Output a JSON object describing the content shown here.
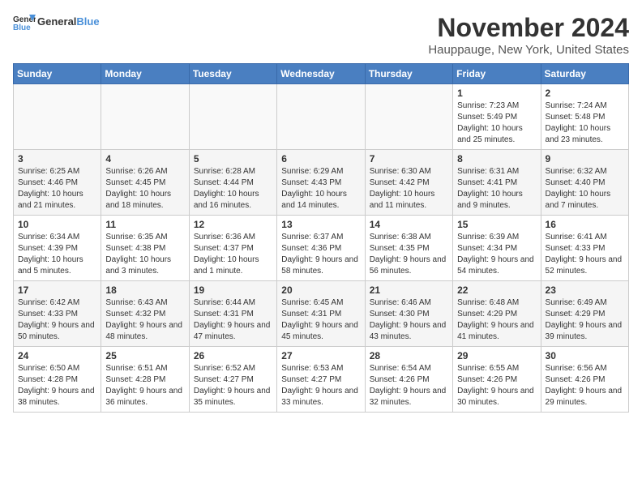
{
  "logo": {
    "text_general": "General",
    "text_blue": "Blue"
  },
  "title": "November 2024",
  "location": "Hauppauge, New York, United States",
  "weekdays": [
    "Sunday",
    "Monday",
    "Tuesday",
    "Wednesday",
    "Thursday",
    "Friday",
    "Saturday"
  ],
  "weeks": [
    [
      {
        "day": "",
        "info": ""
      },
      {
        "day": "",
        "info": ""
      },
      {
        "day": "",
        "info": ""
      },
      {
        "day": "",
        "info": ""
      },
      {
        "day": "",
        "info": ""
      },
      {
        "day": "1",
        "info": "Sunrise: 7:23 AM\nSunset: 5:49 PM\nDaylight: 10 hours and 25 minutes."
      },
      {
        "day": "2",
        "info": "Sunrise: 7:24 AM\nSunset: 5:48 PM\nDaylight: 10 hours and 23 minutes."
      }
    ],
    [
      {
        "day": "3",
        "info": "Sunrise: 6:25 AM\nSunset: 4:46 PM\nDaylight: 10 hours and 21 minutes."
      },
      {
        "day": "4",
        "info": "Sunrise: 6:26 AM\nSunset: 4:45 PM\nDaylight: 10 hours and 18 minutes."
      },
      {
        "day": "5",
        "info": "Sunrise: 6:28 AM\nSunset: 4:44 PM\nDaylight: 10 hours and 16 minutes."
      },
      {
        "day": "6",
        "info": "Sunrise: 6:29 AM\nSunset: 4:43 PM\nDaylight: 10 hours and 14 minutes."
      },
      {
        "day": "7",
        "info": "Sunrise: 6:30 AM\nSunset: 4:42 PM\nDaylight: 10 hours and 11 minutes."
      },
      {
        "day": "8",
        "info": "Sunrise: 6:31 AM\nSunset: 4:41 PM\nDaylight: 10 hours and 9 minutes."
      },
      {
        "day": "9",
        "info": "Sunrise: 6:32 AM\nSunset: 4:40 PM\nDaylight: 10 hours and 7 minutes."
      }
    ],
    [
      {
        "day": "10",
        "info": "Sunrise: 6:34 AM\nSunset: 4:39 PM\nDaylight: 10 hours and 5 minutes."
      },
      {
        "day": "11",
        "info": "Sunrise: 6:35 AM\nSunset: 4:38 PM\nDaylight: 10 hours and 3 minutes."
      },
      {
        "day": "12",
        "info": "Sunrise: 6:36 AM\nSunset: 4:37 PM\nDaylight: 10 hours and 1 minute."
      },
      {
        "day": "13",
        "info": "Sunrise: 6:37 AM\nSunset: 4:36 PM\nDaylight: 9 hours and 58 minutes."
      },
      {
        "day": "14",
        "info": "Sunrise: 6:38 AM\nSunset: 4:35 PM\nDaylight: 9 hours and 56 minutes."
      },
      {
        "day": "15",
        "info": "Sunrise: 6:39 AM\nSunset: 4:34 PM\nDaylight: 9 hours and 54 minutes."
      },
      {
        "day": "16",
        "info": "Sunrise: 6:41 AM\nSunset: 4:33 PM\nDaylight: 9 hours and 52 minutes."
      }
    ],
    [
      {
        "day": "17",
        "info": "Sunrise: 6:42 AM\nSunset: 4:33 PM\nDaylight: 9 hours and 50 minutes."
      },
      {
        "day": "18",
        "info": "Sunrise: 6:43 AM\nSunset: 4:32 PM\nDaylight: 9 hours and 48 minutes."
      },
      {
        "day": "19",
        "info": "Sunrise: 6:44 AM\nSunset: 4:31 PM\nDaylight: 9 hours and 47 minutes."
      },
      {
        "day": "20",
        "info": "Sunrise: 6:45 AM\nSunset: 4:31 PM\nDaylight: 9 hours and 45 minutes."
      },
      {
        "day": "21",
        "info": "Sunrise: 6:46 AM\nSunset: 4:30 PM\nDaylight: 9 hours and 43 minutes."
      },
      {
        "day": "22",
        "info": "Sunrise: 6:48 AM\nSunset: 4:29 PM\nDaylight: 9 hours and 41 minutes."
      },
      {
        "day": "23",
        "info": "Sunrise: 6:49 AM\nSunset: 4:29 PM\nDaylight: 9 hours and 39 minutes."
      }
    ],
    [
      {
        "day": "24",
        "info": "Sunrise: 6:50 AM\nSunset: 4:28 PM\nDaylight: 9 hours and 38 minutes."
      },
      {
        "day": "25",
        "info": "Sunrise: 6:51 AM\nSunset: 4:28 PM\nDaylight: 9 hours and 36 minutes."
      },
      {
        "day": "26",
        "info": "Sunrise: 6:52 AM\nSunset: 4:27 PM\nDaylight: 9 hours and 35 minutes."
      },
      {
        "day": "27",
        "info": "Sunrise: 6:53 AM\nSunset: 4:27 PM\nDaylight: 9 hours and 33 minutes."
      },
      {
        "day": "28",
        "info": "Sunrise: 6:54 AM\nSunset: 4:26 PM\nDaylight: 9 hours and 32 minutes."
      },
      {
        "day": "29",
        "info": "Sunrise: 6:55 AM\nSunset: 4:26 PM\nDaylight: 9 hours and 30 minutes."
      },
      {
        "day": "30",
        "info": "Sunrise: 6:56 AM\nSunset: 4:26 PM\nDaylight: 9 hours and 29 minutes."
      }
    ]
  ]
}
